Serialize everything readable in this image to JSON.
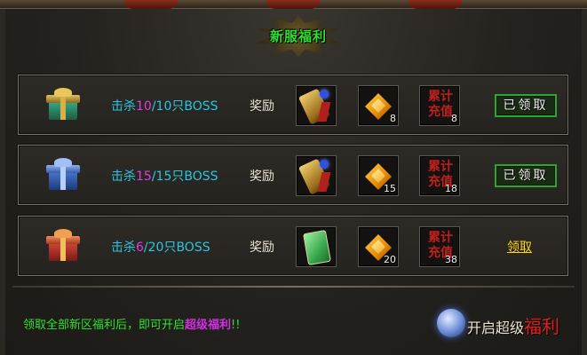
{
  "header": {
    "badge_title": "新服福利"
  },
  "rows": [
    {
      "kill_prefix": "击杀",
      "kill_current": "10",
      "kill_suffix": "/10只BOSS",
      "reward_label": "奖励",
      "slot2_count": "8",
      "slot3_text_line1": "累计",
      "slot3_text_line2": "充值",
      "slot3_count": "8",
      "action_label": "已领取",
      "status": "claimed",
      "gift_color": "#2e8a6a",
      "slot1_icon": "weapon-icon"
    },
    {
      "kill_prefix": "击杀",
      "kill_current": "15",
      "kill_suffix": "/15只BOSS",
      "reward_label": "奖励",
      "slot2_count": "15",
      "slot3_text_line1": "累计",
      "slot3_text_line2": "充值",
      "slot3_count": "18",
      "action_label": "已领取",
      "status": "claimed",
      "gift_color": "#2a5ab0",
      "slot1_icon": "weapon-icon"
    },
    {
      "kill_prefix": "击杀",
      "kill_current": "6",
      "kill_suffix": "/20只BOSS",
      "reward_label": "奖励",
      "slot2_count": "20",
      "slot3_text_line1": "累计",
      "slot3_text_line2": "充值",
      "slot3_count": "38",
      "action_label": "领取",
      "status": "claimable",
      "gift_color": "#b02a2a",
      "slot1_icon": "scroll-icon"
    }
  ],
  "footer": {
    "text_before": "领取全部新区福利后，即可开启",
    "text_highlight": "超级福利",
    "text_after": "!!",
    "open_button_prefix": "开启超级",
    "open_button_red": "福利"
  },
  "colors": {
    "cyan_text": "#29c6e0",
    "magenta_num": "#e23be2",
    "green_text": "#2ee02e",
    "claim_yellow": "#ffd21c"
  }
}
